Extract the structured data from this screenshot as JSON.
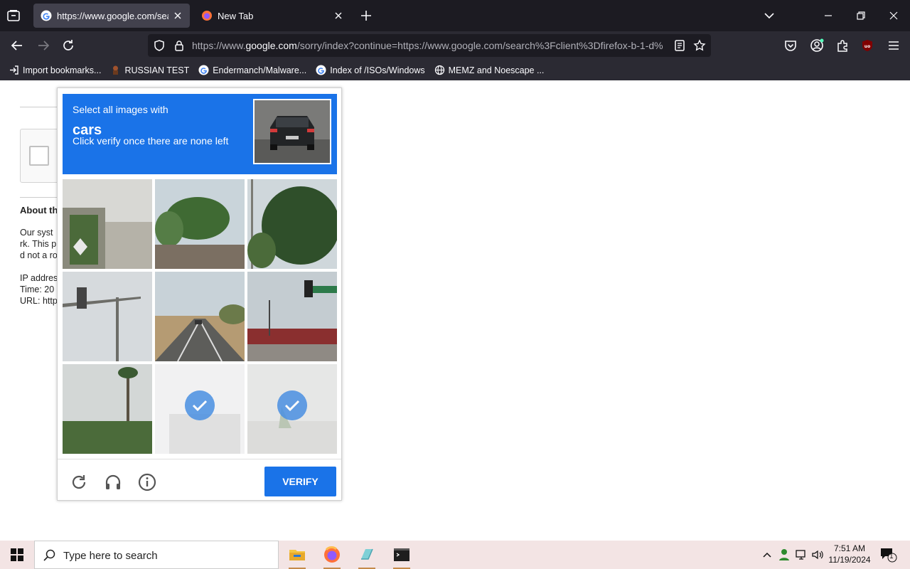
{
  "browser": {
    "tabs": [
      {
        "title": "https://www.google.com/search",
        "active": true
      },
      {
        "title": "New Tab",
        "active": false
      }
    ],
    "url_host_prefix": "https://www.",
    "url_host": "google.com",
    "url_rest": "/sorry/index?continue=https://www.google.com/search%3Fclient%3Dfirefox-b-1-d%",
    "bookmarks": [
      {
        "label": "Import bookmarks...",
        "icon": "import-icon"
      },
      {
        "label": "RUSSIAN TEST",
        "icon": "figure-icon"
      },
      {
        "label": "Endermanch/Malware...",
        "icon": "google-icon"
      },
      {
        "label": "Index of /ISOs/Windows",
        "icon": "google-icon"
      },
      {
        "label": "MEMZ and Noescape ...",
        "icon": "globe-icon"
      }
    ]
  },
  "page": {
    "about_heading": "About th",
    "lines": [
      "Our syst",
      "rk. This p",
      "d not a ro",
      "IP addres",
      "Time: 20",
      "URL: http"
    ]
  },
  "captcha": {
    "instruction": "Select all images with",
    "target": "cars",
    "sub_instruction": "Click verify once there are none left",
    "verify_label": "VERIFY",
    "tiles": [
      {
        "scene": "building-wall",
        "selected": false
      },
      {
        "scene": "palm-tree",
        "selected": false
      },
      {
        "scene": "trees",
        "selected": false
      },
      {
        "scene": "traffic-light",
        "selected": false
      },
      {
        "scene": "road",
        "selected": false
      },
      {
        "scene": "traffic-light-street",
        "selected": false
      },
      {
        "scene": "palm-trees",
        "selected": false
      },
      {
        "scene": "blank",
        "selected": true
      },
      {
        "scene": "road-sign",
        "selected": true
      }
    ]
  },
  "taskbar": {
    "search_placeholder": "Type here to search",
    "time": "7:51 AM",
    "date": "11/19/2024",
    "notification_count": "1"
  },
  "colors": {
    "captcha_blue": "#1a73e8",
    "browser_dark": "#1c1b22",
    "toolbar": "#2b2a33"
  }
}
